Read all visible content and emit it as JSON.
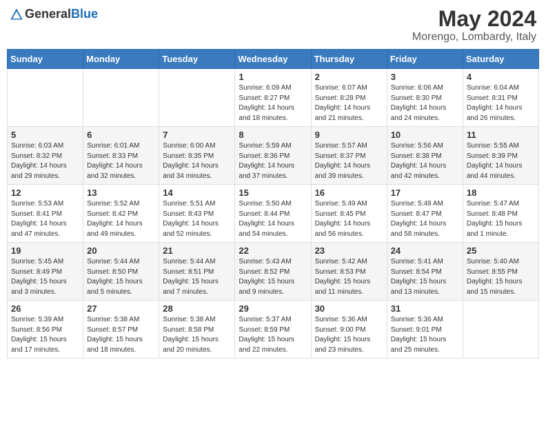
{
  "header": {
    "logo_general": "General",
    "logo_blue": "Blue",
    "month": "May 2024",
    "location": "Morengo, Lombardy, Italy"
  },
  "days_of_week": [
    "Sunday",
    "Monday",
    "Tuesday",
    "Wednesday",
    "Thursday",
    "Friday",
    "Saturday"
  ],
  "weeks": [
    [
      {
        "day": "",
        "info": ""
      },
      {
        "day": "",
        "info": ""
      },
      {
        "day": "",
        "info": ""
      },
      {
        "day": "1",
        "info": "Sunrise: 6:09 AM\nSunset: 8:27 PM\nDaylight: 14 hours\nand 18 minutes."
      },
      {
        "day": "2",
        "info": "Sunrise: 6:07 AM\nSunset: 8:28 PM\nDaylight: 14 hours\nand 21 minutes."
      },
      {
        "day": "3",
        "info": "Sunrise: 6:06 AM\nSunset: 8:30 PM\nDaylight: 14 hours\nand 24 minutes."
      },
      {
        "day": "4",
        "info": "Sunrise: 6:04 AM\nSunset: 8:31 PM\nDaylight: 14 hours\nand 26 minutes."
      }
    ],
    [
      {
        "day": "5",
        "info": "Sunrise: 6:03 AM\nSunset: 8:32 PM\nDaylight: 14 hours\nand 29 minutes."
      },
      {
        "day": "6",
        "info": "Sunrise: 6:01 AM\nSunset: 8:33 PM\nDaylight: 14 hours\nand 32 minutes."
      },
      {
        "day": "7",
        "info": "Sunrise: 6:00 AM\nSunset: 8:35 PM\nDaylight: 14 hours\nand 34 minutes."
      },
      {
        "day": "8",
        "info": "Sunrise: 5:59 AM\nSunset: 8:36 PM\nDaylight: 14 hours\nand 37 minutes."
      },
      {
        "day": "9",
        "info": "Sunrise: 5:57 AM\nSunset: 8:37 PM\nDaylight: 14 hours\nand 39 minutes."
      },
      {
        "day": "10",
        "info": "Sunrise: 5:56 AM\nSunset: 8:38 PM\nDaylight: 14 hours\nand 42 minutes."
      },
      {
        "day": "11",
        "info": "Sunrise: 5:55 AM\nSunset: 8:39 PM\nDaylight: 14 hours\nand 44 minutes."
      }
    ],
    [
      {
        "day": "12",
        "info": "Sunrise: 5:53 AM\nSunset: 8:41 PM\nDaylight: 14 hours\nand 47 minutes."
      },
      {
        "day": "13",
        "info": "Sunrise: 5:52 AM\nSunset: 8:42 PM\nDaylight: 14 hours\nand 49 minutes."
      },
      {
        "day": "14",
        "info": "Sunrise: 5:51 AM\nSunset: 8:43 PM\nDaylight: 14 hours\nand 52 minutes."
      },
      {
        "day": "15",
        "info": "Sunrise: 5:50 AM\nSunset: 8:44 PM\nDaylight: 14 hours\nand 54 minutes."
      },
      {
        "day": "16",
        "info": "Sunrise: 5:49 AM\nSunset: 8:45 PM\nDaylight: 14 hours\nand 56 minutes."
      },
      {
        "day": "17",
        "info": "Sunrise: 5:48 AM\nSunset: 8:47 PM\nDaylight: 14 hours\nand 58 minutes."
      },
      {
        "day": "18",
        "info": "Sunrise: 5:47 AM\nSunset: 8:48 PM\nDaylight: 15 hours\nand 1 minute."
      }
    ],
    [
      {
        "day": "19",
        "info": "Sunrise: 5:45 AM\nSunset: 8:49 PM\nDaylight: 15 hours\nand 3 minutes."
      },
      {
        "day": "20",
        "info": "Sunrise: 5:44 AM\nSunset: 8:50 PM\nDaylight: 15 hours\nand 5 minutes."
      },
      {
        "day": "21",
        "info": "Sunrise: 5:44 AM\nSunset: 8:51 PM\nDaylight: 15 hours\nand 7 minutes."
      },
      {
        "day": "22",
        "info": "Sunrise: 5:43 AM\nSunset: 8:52 PM\nDaylight: 15 hours\nand 9 minutes."
      },
      {
        "day": "23",
        "info": "Sunrise: 5:42 AM\nSunset: 8:53 PM\nDaylight: 15 hours\nand 11 minutes."
      },
      {
        "day": "24",
        "info": "Sunrise: 5:41 AM\nSunset: 8:54 PM\nDaylight: 15 hours\nand 13 minutes."
      },
      {
        "day": "25",
        "info": "Sunrise: 5:40 AM\nSunset: 8:55 PM\nDaylight: 15 hours\nand 15 minutes."
      }
    ],
    [
      {
        "day": "26",
        "info": "Sunrise: 5:39 AM\nSunset: 8:56 PM\nDaylight: 15 hours\nand 17 minutes."
      },
      {
        "day": "27",
        "info": "Sunrise: 5:38 AM\nSunset: 8:57 PM\nDaylight: 15 hours\nand 18 minutes."
      },
      {
        "day": "28",
        "info": "Sunrise: 5:38 AM\nSunset: 8:58 PM\nDaylight: 15 hours\nand 20 minutes."
      },
      {
        "day": "29",
        "info": "Sunrise: 5:37 AM\nSunset: 8:59 PM\nDaylight: 15 hours\nand 22 minutes."
      },
      {
        "day": "30",
        "info": "Sunrise: 5:36 AM\nSunset: 9:00 PM\nDaylight: 15 hours\nand 23 minutes."
      },
      {
        "day": "31",
        "info": "Sunrise: 5:36 AM\nSunset: 9:01 PM\nDaylight: 15 hours\nand 25 minutes."
      },
      {
        "day": "",
        "info": ""
      }
    ]
  ]
}
